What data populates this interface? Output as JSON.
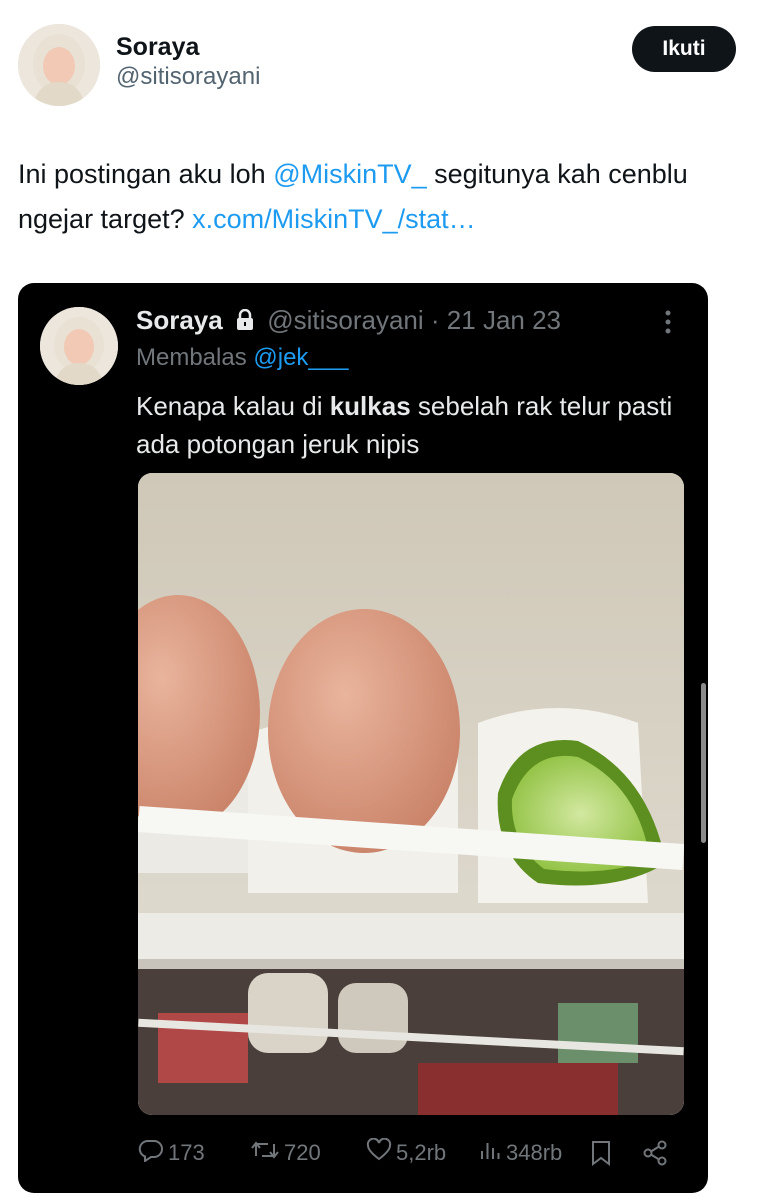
{
  "author": {
    "name": "Soraya",
    "handle": "@sitisorayani",
    "follow_label": "Ikuti"
  },
  "tweet": {
    "text_part1": "Ini postingan aku loh ",
    "mention": "@MiskinTV_",
    "text_part2": " segitunya kah cenblu ngejar target? ",
    "link": "x.com/MiskinTV_/stat…"
  },
  "quoted": {
    "name": "Soraya",
    "handle": "@sitisorayani",
    "separator": "·",
    "date": "21 Jan 23",
    "reply_prefix": "Membalas ",
    "reply_mention": "@jek___",
    "text_part1": "Kenapa kalau di ",
    "text_bold": "kulkas",
    "text_part2": " sebelah rak telur pasti ada potongan jeruk nipis",
    "stats": {
      "replies": "173",
      "reposts": "720",
      "likes": "5,2rb",
      "views": "348rb"
    }
  },
  "colors": {
    "link": "#1d9bf0",
    "card_bg": "#000000",
    "gray": "#71767b"
  }
}
